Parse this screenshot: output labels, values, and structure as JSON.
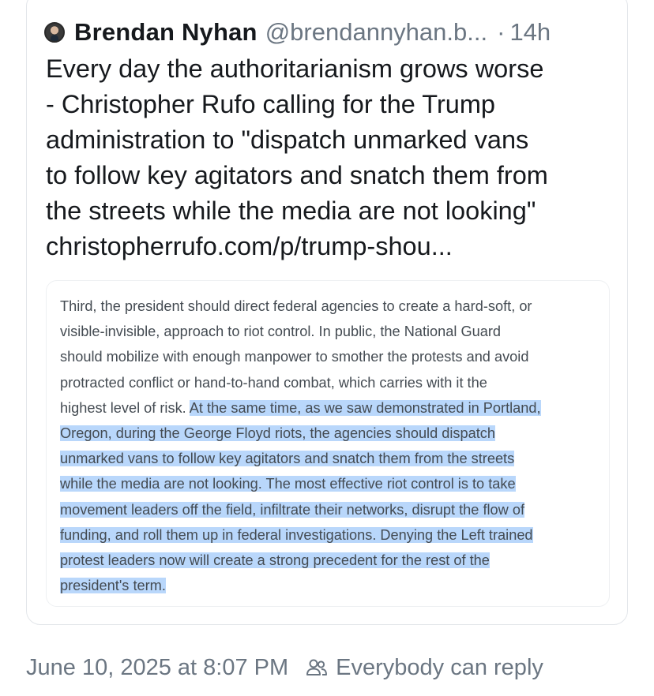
{
  "post": {
    "author": {
      "display_name": "Brendan Nyhan",
      "handle": "@brendannyhan.b...",
      "avatar_icon": "user-avatar"
    },
    "separator": "·",
    "relative_time": "14h",
    "text_lines": [
      "Every day the authoritarianism grows worse",
      "- Christopher Rufo calling for the Trump",
      "administration to \"dispatch unmarked vans",
      "to follow key agitators and snatch them from",
      "the streets while the media are not looking\"",
      "christopherrufo.com/p/trump-shou..."
    ],
    "embed": {
      "lines": [
        {
          "plain": "Third, the president should direct federal agencies to create a hard-soft, or",
          "highlight": ""
        },
        {
          "plain": "visible-invisible, approach to riot control. In public, the National Guard",
          "highlight": ""
        },
        {
          "plain": "should mobilize with enough manpower to smother the protests and avoid",
          "highlight": ""
        },
        {
          "plain": "protracted conflict or hand-to-hand combat, which carries with it the",
          "highlight": ""
        },
        {
          "plain": "highest level of risk. ",
          "highlight": "At the same time, as we saw demonstrated in Portland,"
        },
        {
          "plain": "",
          "highlight": "Oregon, during the George Floyd riots, the agencies should dispatch"
        },
        {
          "plain": "",
          "highlight": "unmarked vans to follow key agitators and snatch them from the streets"
        },
        {
          "plain": "",
          "highlight": "while the media are not looking. The most effective riot control is to take"
        },
        {
          "plain": "",
          "highlight": "movement leaders off the field, infiltrate their networks, disrupt the flow of"
        },
        {
          "plain": "",
          "highlight": "funding, and roll them up in federal investigations. Denying the Left trained"
        },
        {
          "plain": "",
          "highlight": "protest leaders now will create a strong precedent for the rest of the"
        },
        {
          "plain": "",
          "highlight": "president's term."
        }
      ],
      "highlight_color": "#b9d7fb"
    }
  },
  "footer": {
    "datetime": "June 10, 2025 at 8:07 PM",
    "reply_icon": "people-icon",
    "reply_setting": "Everybody can reply"
  },
  "colors": {
    "text_primary": "#16191d",
    "text_secondary": "#6b7682",
    "card_border": "#e3e6ea"
  }
}
